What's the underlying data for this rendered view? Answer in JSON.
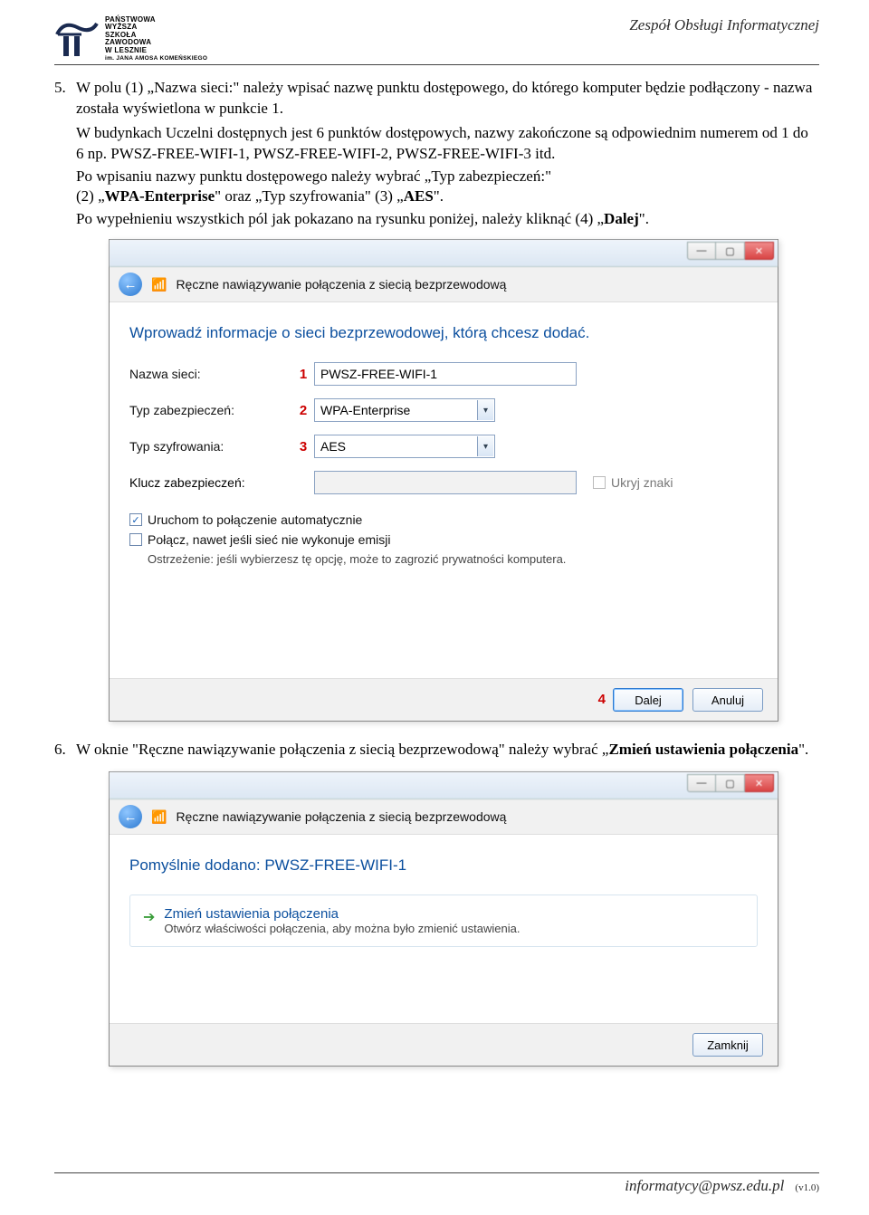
{
  "header": {
    "logo_lines": [
      "PAŃSTWOWA",
      "WYŻSZA",
      "SZKOŁA",
      "ZAWODOWA",
      "W LESZNIE"
    ],
    "logo_sub": "im. JANA AMOSA KOMEŃSKIEGO",
    "right": "Zespół Obsługi Informatycznej"
  },
  "step5": {
    "num": "5.",
    "p1a": "W polu (1) „Nazwa sieci:\" należy wpisać nazwę punktu dostępowego, do którego komputer będzie podłączony - nazwa została wyświetlona w punkcie 1.",
    "p1b": "W budynkach Uczelni dostępnych jest 6 punktów dostępowych, nazwy zakończone są odpowiednim numerem od 1 do 6 np. PWSZ-FREE-WIFI-1, PWSZ-FREE-WIFI-2, PWSZ-FREE-WIFI-3 itd.",
    "p1c_a": "Po wpisaniu nazwy punktu dostępowego należy wybrać „Typ zabezpieczeń:\"",
    "p1c_b": "(2) „",
    "p1c_bold1": "WPA-Enterprise",
    "p1c_c": "\" oraz „Typ szyfrowania\" (3) „",
    "p1c_bold2": "AES",
    "p1c_d": "\".",
    "p1d_a": "Po wypełnieniu wszystkich pól jak pokazano na rysunku poniżej, należy kliknąć (4) „",
    "p1d_bold": "Dalej",
    "p1d_b": "\"."
  },
  "dialog1": {
    "crumb": "Ręczne nawiązywanie połączenia z siecią bezprzewodową",
    "heading": "Wprowadź informacje o sieci bezprzewodowej, którą chcesz dodać.",
    "labels": {
      "name": "Nazwa sieci:",
      "security": "Typ zabezpieczeń:",
      "encryption": "Typ szyfrowania:",
      "key": "Klucz zabezpieczeń:"
    },
    "markers": {
      "m1": "1",
      "m2": "2",
      "m3": "3",
      "m4": "4"
    },
    "values": {
      "name": "PWSZ-FREE-WIFI-1",
      "security": "WPA-Enterprise",
      "encryption": "AES",
      "key": ""
    },
    "hide_chars": "Ukryj znaki",
    "auto_start": "Uruchom to połączenie automatycznie",
    "connect_hidden": "Połącz, nawet jeśli sieć nie wykonuje emisji",
    "warning": "Ostrzeżenie: jeśli wybierzesz tę opcję, może to zagrozić prywatności komputera.",
    "btn_next": "Dalej",
    "btn_cancel": "Anuluj"
  },
  "step6": {
    "num": "6.",
    "text_a": "W oknie \"Ręczne nawiązywanie połączenia z siecią bezprzewodową\" należy wybrać „",
    "text_bold": "Zmień ustawienia połączenia",
    "text_b": "\"."
  },
  "dialog2": {
    "crumb": "Ręczne nawiązywanie połączenia z siecią bezprzewodową",
    "heading": "Pomyślnie dodano: PWSZ-FREE-WIFI-1",
    "link_title": "Zmień ustawienia połączenia",
    "link_sub": "Otwórz właściwości połączenia, aby można było zmienić ustawienia.",
    "btn_close": "Zamknij"
  },
  "footer": {
    "email": "informatycy@pwsz.edu.pl",
    "ver": "(v1.0)"
  }
}
